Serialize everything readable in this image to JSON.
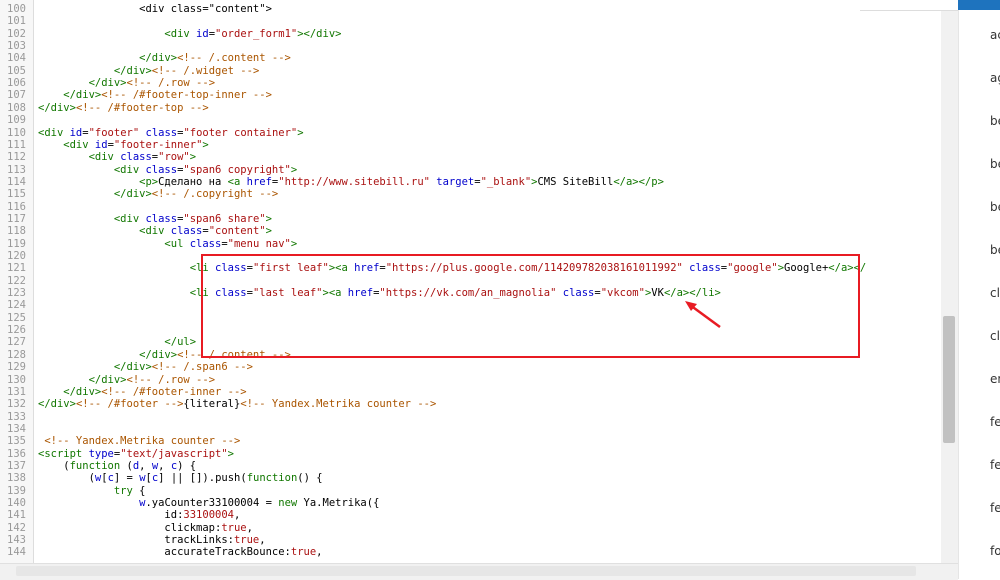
{
  "editor": {
    "lines": [
      {
        "n": "100",
        "tokens": [
          {
            "t": "                <div class=\"content\">",
            "c": ""
          }
        ]
      },
      {
        "n": "101",
        "tokens": [
          {
            "t": "",
            "c": ""
          }
        ]
      },
      {
        "n": "102",
        "tokens": [
          {
            "t": "                    <div ",
            "c": "t"
          },
          {
            "t": "id",
            "c": "a"
          },
          {
            "t": "=",
            "c": ""
          },
          {
            "t": "\"order_form1\"",
            "c": "s"
          },
          {
            "t": "></div>",
            "c": "t"
          }
        ]
      },
      {
        "n": "103",
        "tokens": [
          {
            "t": "",
            "c": ""
          }
        ]
      },
      {
        "n": "104",
        "tokens": [
          {
            "t": "                </div>",
            "c": "t"
          },
          {
            "t": "<!-- /.content -->",
            "c": "c"
          }
        ]
      },
      {
        "n": "105",
        "tokens": [
          {
            "t": "            </div>",
            "c": "t"
          },
          {
            "t": "<!-- /.widget -->",
            "c": "c"
          }
        ]
      },
      {
        "n": "106",
        "tokens": [
          {
            "t": "        </div>",
            "c": "t"
          },
          {
            "t": "<!-- /.row -->",
            "c": "c"
          }
        ]
      },
      {
        "n": "107",
        "tokens": [
          {
            "t": "    </div>",
            "c": "t"
          },
          {
            "t": "<!-- /#footer-top-inner -->",
            "c": "c"
          }
        ]
      },
      {
        "n": "108",
        "tokens": [
          {
            "t": "</div>",
            "c": "t"
          },
          {
            "t": "<!-- /#footer-top -->",
            "c": "c"
          }
        ]
      },
      {
        "n": "109",
        "tokens": [
          {
            "t": "",
            "c": ""
          }
        ]
      },
      {
        "n": "110",
        "tokens": [
          {
            "t": "<div ",
            "c": "t"
          },
          {
            "t": "id",
            "c": "a"
          },
          {
            "t": "=",
            "c": ""
          },
          {
            "t": "\"footer\"",
            "c": "s"
          },
          {
            "t": " class",
            "c": "a"
          },
          {
            "t": "=",
            "c": ""
          },
          {
            "t": "\"footer container\"",
            "c": "s"
          },
          {
            "t": ">",
            "c": "t"
          }
        ]
      },
      {
        "n": "111",
        "tokens": [
          {
            "t": "    <div ",
            "c": "t"
          },
          {
            "t": "id",
            "c": "a"
          },
          {
            "t": "=",
            "c": ""
          },
          {
            "t": "\"footer-inner\"",
            "c": "s"
          },
          {
            "t": ">",
            "c": "t"
          }
        ]
      },
      {
        "n": "112",
        "tokens": [
          {
            "t": "        <div ",
            "c": "t"
          },
          {
            "t": "class",
            "c": "a"
          },
          {
            "t": "=",
            "c": ""
          },
          {
            "t": "\"row\"",
            "c": "s"
          },
          {
            "t": ">",
            "c": "t"
          }
        ]
      },
      {
        "n": "113",
        "tokens": [
          {
            "t": "            <div ",
            "c": "t"
          },
          {
            "t": "class",
            "c": "a"
          },
          {
            "t": "=",
            "c": ""
          },
          {
            "t": "\"span6 copyright\"",
            "c": "s"
          },
          {
            "t": ">",
            "c": "t"
          }
        ]
      },
      {
        "n": "114",
        "tokens": [
          {
            "t": "                <p>",
            "c": "t"
          },
          {
            "t": "Сделано на ",
            "c": ""
          },
          {
            "t": "<a ",
            "c": "t"
          },
          {
            "t": "href",
            "c": "a"
          },
          {
            "t": "=",
            "c": ""
          },
          {
            "t": "\"http://www.sitebill.ru\"",
            "c": "s"
          },
          {
            "t": " target",
            "c": "a"
          },
          {
            "t": "=",
            "c": ""
          },
          {
            "t": "\"_blank\"",
            "c": "s"
          },
          {
            "t": ">",
            "c": "t"
          },
          {
            "t": "CMS SiteBill",
            "c": ""
          },
          {
            "t": "</a></p>",
            "c": "t"
          }
        ]
      },
      {
        "n": "115",
        "tokens": [
          {
            "t": "            </div>",
            "c": "t"
          },
          {
            "t": "<!-- /.copyright -->",
            "c": "c"
          }
        ]
      },
      {
        "n": "116",
        "tokens": [
          {
            "t": "",
            "c": ""
          }
        ]
      },
      {
        "n": "117",
        "tokens": [
          {
            "t": "            <div ",
            "c": "t"
          },
          {
            "t": "class",
            "c": "a"
          },
          {
            "t": "=",
            "c": ""
          },
          {
            "t": "\"span6 share\"",
            "c": "s"
          },
          {
            "t": ">",
            "c": "t"
          }
        ]
      },
      {
        "n": "118",
        "tokens": [
          {
            "t": "                <div ",
            "c": "t"
          },
          {
            "t": "class",
            "c": "a"
          },
          {
            "t": "=",
            "c": ""
          },
          {
            "t": "\"content\"",
            "c": "s"
          },
          {
            "t": ">",
            "c": "t"
          }
        ]
      },
      {
        "n": "119",
        "tokens": [
          {
            "t": "                    <ul ",
            "c": "t"
          },
          {
            "t": "class",
            "c": "a"
          },
          {
            "t": "=",
            "c": ""
          },
          {
            "t": "\"menu nav\"",
            "c": "s"
          },
          {
            "t": ">",
            "c": "t"
          }
        ]
      },
      {
        "n": "120",
        "tokens": [
          {
            "t": "",
            "c": ""
          }
        ]
      },
      {
        "n": "121",
        "tokens": [
          {
            "t": "                        <li ",
            "c": "t"
          },
          {
            "t": "class",
            "c": "a"
          },
          {
            "t": "=",
            "c": ""
          },
          {
            "t": "\"first leaf\"",
            "c": "s"
          },
          {
            "t": "><a ",
            "c": "t"
          },
          {
            "t": "href",
            "c": "a"
          },
          {
            "t": "=",
            "c": ""
          },
          {
            "t": "\"https://plus.google.com/114209782038161011992\"",
            "c": "s"
          },
          {
            "t": " class",
            "c": "a"
          },
          {
            "t": "=",
            "c": ""
          },
          {
            "t": "\"google\"",
            "c": "s"
          },
          {
            "t": ">",
            "c": "t"
          },
          {
            "t": "Google+",
            "c": ""
          },
          {
            "t": "</a></",
            "c": "t"
          }
        ]
      },
      {
        "n": "122",
        "tokens": [
          {
            "t": "",
            "c": ""
          }
        ]
      },
      {
        "n": "123",
        "tokens": [
          {
            "t": "                        <li ",
            "c": "t"
          },
          {
            "t": "class",
            "c": "a"
          },
          {
            "t": "=",
            "c": ""
          },
          {
            "t": "\"last leaf\"",
            "c": "s"
          },
          {
            "t": "><a ",
            "c": "t"
          },
          {
            "t": "href",
            "c": "a"
          },
          {
            "t": "=",
            "c": ""
          },
          {
            "t": "\"https://vk.com/an_magnolia\"",
            "c": "s"
          },
          {
            "t": " class",
            "c": "a"
          },
          {
            "t": "=",
            "c": ""
          },
          {
            "t": "\"vkcom\"",
            "c": "s"
          },
          {
            "t": ">",
            "c": "t"
          },
          {
            "t": "VK",
            "c": ""
          },
          {
            "t": "</a></li>",
            "c": "t"
          }
        ]
      },
      {
        "n": "124",
        "tokens": [
          {
            "t": "",
            "c": ""
          }
        ]
      },
      {
        "n": "125",
        "tokens": [
          {
            "t": "",
            "c": ""
          }
        ]
      },
      {
        "n": "126",
        "tokens": [
          {
            "t": "",
            "c": ""
          }
        ]
      },
      {
        "n": "127",
        "tokens": [
          {
            "t": "                    </ul>",
            "c": "t"
          }
        ]
      },
      {
        "n": "128",
        "tokens": [
          {
            "t": "                </div>",
            "c": "t"
          },
          {
            "t": "<!-- /.content -->",
            "c": "c"
          }
        ]
      },
      {
        "n": "129",
        "tokens": [
          {
            "t": "            </div>",
            "c": "t"
          },
          {
            "t": "<!-- /.span6 -->",
            "c": "c"
          }
        ]
      },
      {
        "n": "130",
        "tokens": [
          {
            "t": "        </div>",
            "c": "t"
          },
          {
            "t": "<!-- /.row -->",
            "c": "c"
          }
        ]
      },
      {
        "n": "131",
        "tokens": [
          {
            "t": "    </div>",
            "c": "t"
          },
          {
            "t": "<!-- /#footer-inner -->",
            "c": "c"
          }
        ]
      },
      {
        "n": "132",
        "tokens": [
          {
            "t": "</div>",
            "c": "t"
          },
          {
            "t": "<!-- /#footer -->",
            "c": "c"
          },
          {
            "t": "{literal}",
            "c": ""
          },
          {
            "t": "<!-- Yandex.Metrika counter -->",
            "c": "c"
          }
        ]
      },
      {
        "n": "133",
        "tokens": [
          {
            "t": "",
            "c": ""
          }
        ]
      },
      {
        "n": "134",
        "tokens": [
          {
            "t": "",
            "c": ""
          }
        ]
      },
      {
        "n": "135",
        "tokens": [
          {
            "t": " <!-- Yandex.Metrika counter -->",
            "c": "c"
          }
        ]
      },
      {
        "n": "136",
        "tokens": [
          {
            "t": "<script ",
            "c": "t"
          },
          {
            "t": "type",
            "c": "a"
          },
          {
            "t": "=",
            "c": ""
          },
          {
            "t": "\"text/javascript\"",
            "c": "s"
          },
          {
            "t": ">",
            "c": "t"
          }
        ]
      },
      {
        "n": "137",
        "tokens": [
          {
            "t": "    (",
            "c": ""
          },
          {
            "t": "function",
            "c": "k"
          },
          {
            "t": " (",
            "c": ""
          },
          {
            "t": "d",
            "c": "a"
          },
          {
            "t": ", ",
            "c": ""
          },
          {
            "t": "w",
            "c": "a"
          },
          {
            "t": ", ",
            "c": ""
          },
          {
            "t": "c",
            "c": "a"
          },
          {
            "t": ") {",
            "c": ""
          }
        ]
      },
      {
        "n": "138",
        "tokens": [
          {
            "t": "        (",
            "c": ""
          },
          {
            "t": "w",
            "c": "a"
          },
          {
            "t": "[",
            "c": ""
          },
          {
            "t": "c",
            "c": "a"
          },
          {
            "t": "] = ",
            "c": ""
          },
          {
            "t": "w",
            "c": "a"
          },
          {
            "t": "[",
            "c": ""
          },
          {
            "t": "c",
            "c": "a"
          },
          {
            "t": "] || []).push(",
            "c": ""
          },
          {
            "t": "function",
            "c": "k"
          },
          {
            "t": "() {",
            "c": ""
          }
        ]
      },
      {
        "n": "139",
        "tokens": [
          {
            "t": "            ",
            "c": ""
          },
          {
            "t": "try",
            "c": "k"
          },
          {
            "t": " {",
            "c": ""
          }
        ]
      },
      {
        "n": "140",
        "tokens": [
          {
            "t": "                ",
            "c": ""
          },
          {
            "t": "w",
            "c": "a"
          },
          {
            "t": ".yaCounter33100004 = ",
            "c": ""
          },
          {
            "t": "new",
            "c": "k"
          },
          {
            "t": " Ya.Metrika({",
            "c": ""
          }
        ]
      },
      {
        "n": "141",
        "tokens": [
          {
            "t": "                    id:",
            "c": ""
          },
          {
            "t": "33100004",
            "c": "s"
          },
          {
            "t": ",",
            "c": ""
          }
        ]
      },
      {
        "n": "142",
        "tokens": [
          {
            "t": "                    clickmap:",
            "c": ""
          },
          {
            "t": "true",
            "c": "s"
          },
          {
            "t": ",",
            "c": ""
          }
        ]
      },
      {
        "n": "143",
        "tokens": [
          {
            "t": "                    trackLinks:",
            "c": ""
          },
          {
            "t": "true",
            "c": "s"
          },
          {
            "t": ",",
            "c": ""
          }
        ]
      },
      {
        "n": "144",
        "tokens": [
          {
            "t": "                    accurateTrackBounce:",
            "c": ""
          },
          {
            "t": "true",
            "c": "s"
          },
          {
            "t": ",",
            "c": ""
          }
        ]
      }
    ]
  },
  "right_panel": {
    "items": [
      "ac",
      "ag",
      "be",
      "be",
      "be",
      "be",
      "cl",
      "cl",
      "en",
      "fe",
      "fe",
      "fe",
      "fo"
    ]
  },
  "colors": {
    "highlight_box": "#e81b23",
    "arrow": "#e81b23",
    "panel_accent": "#1e73be"
  },
  "icons": {
    "annotation_arrow": "arrow-icon"
  }
}
